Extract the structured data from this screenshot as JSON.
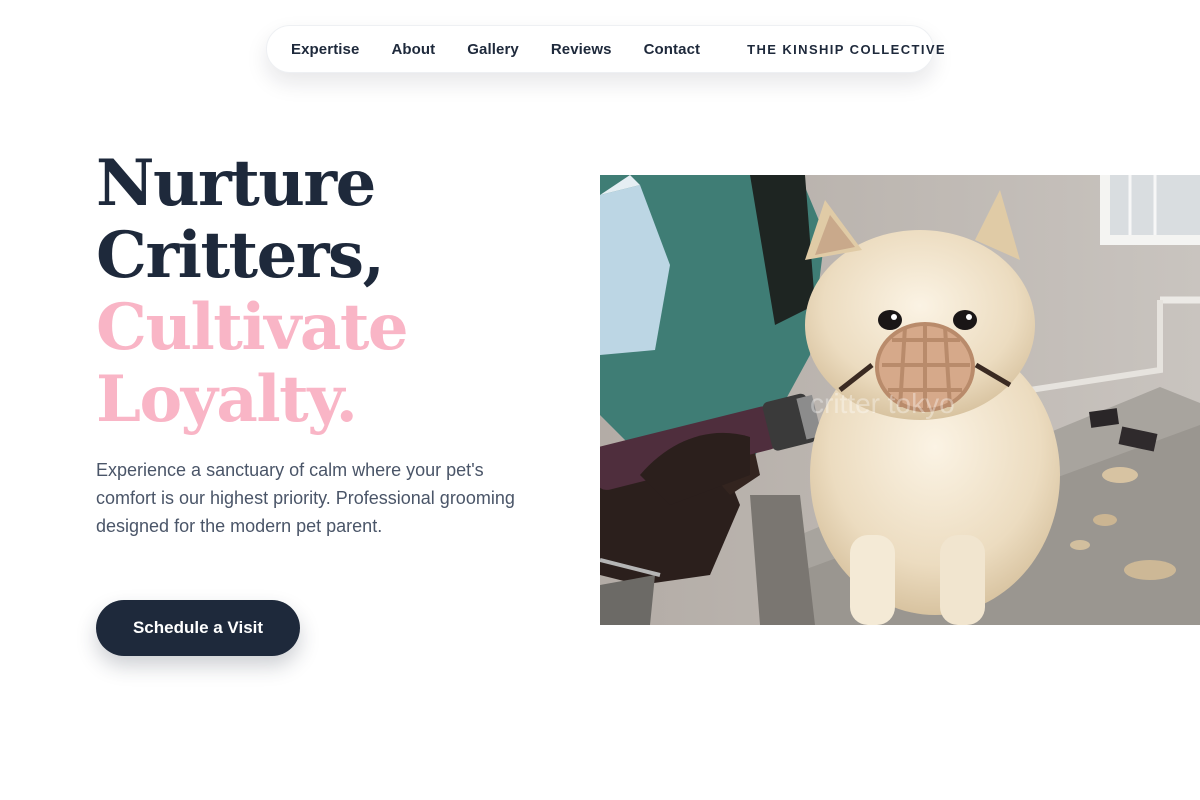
{
  "nav": {
    "links": [
      "Expertise",
      "About",
      "Gallery",
      "Reviews",
      "Contact"
    ],
    "brand": "THE KINSHIP COLLECTIVE"
  },
  "hero": {
    "headline_lines": [
      "Nurture",
      "Critters,",
      "Cultivate",
      "Loyalty."
    ],
    "lead": "Experience a sanctuary of calm where your pet's comfort is our highest priority. Professional grooming designed for the modern pet parent.",
    "cta_label": "Schedule a Visit"
  },
  "photo": {
    "watermark": "critter tokyo",
    "subject": "groomer-clipping-muzzled-pomeranian"
  },
  "colors": {
    "ink": "#1e293b",
    "accent_pink": "#f9b5c6",
    "body_text": "#4a5568"
  }
}
